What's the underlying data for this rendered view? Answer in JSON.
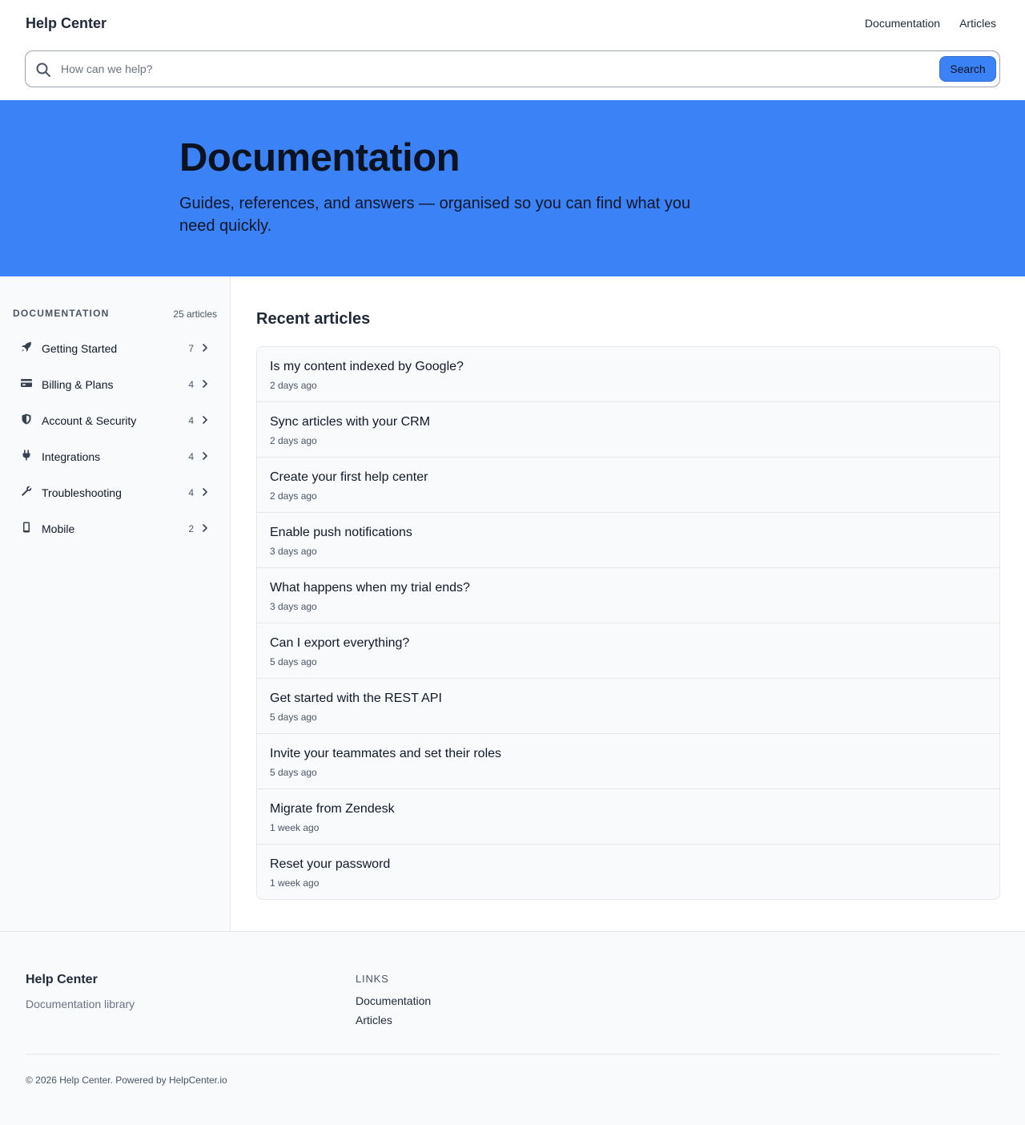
{
  "header": {
    "brand": "Help Center",
    "nav": [
      {
        "label": "Documentation"
      },
      {
        "label": "Articles"
      }
    ],
    "search": {
      "placeholder": "How can we help?",
      "value": "",
      "button_label": "Search"
    }
  },
  "hero": {
    "title": "Documentation",
    "subtitle": "Guides, references, and answers — organised so you can find what you need quickly."
  },
  "sidebar": {
    "heading": "DOCUMENTATION",
    "count_label": "25 articles",
    "items": [
      {
        "label": "Getting Started",
        "count": "7",
        "icon": "rocket-icon"
      },
      {
        "label": "Billing & Plans",
        "count": "4",
        "icon": "credit-card-icon"
      },
      {
        "label": "Account & Security",
        "count": "4",
        "icon": "shield-icon"
      },
      {
        "label": "Integrations",
        "count": "4",
        "icon": "plug-icon"
      },
      {
        "label": "Troubleshooting",
        "count": "4",
        "icon": "wrench-icon"
      },
      {
        "label": "Mobile",
        "count": "2",
        "icon": "mobile-icon"
      }
    ]
  },
  "main": {
    "heading": "Recent articles",
    "articles": [
      {
        "title": "Is my content indexed by Google?",
        "date": "2 days ago"
      },
      {
        "title": "Sync articles with your CRM",
        "date": "2 days ago"
      },
      {
        "title": "Create your first help center",
        "date": "2 days ago"
      },
      {
        "title": "Enable push notifications",
        "date": "3 days ago"
      },
      {
        "title": "What happens when my trial ends?",
        "date": "3 days ago"
      },
      {
        "title": "Can I export everything?",
        "date": "5 days ago"
      },
      {
        "title": "Get started with the REST API",
        "date": "5 days ago"
      },
      {
        "title": "Invite your teammates and set their roles",
        "date": "5 days ago"
      },
      {
        "title": "Migrate from Zendesk",
        "date": "1 week ago"
      },
      {
        "title": "Reset your password",
        "date": "1 week ago"
      }
    ]
  },
  "footer": {
    "brand": "Help Center",
    "tagline": "Documentation library",
    "links_heading": "LINKS",
    "links": [
      {
        "label": "Documentation"
      },
      {
        "label": "Articles"
      }
    ],
    "copyright": "© 2026 Help Center. Powered by HelpCenter.io"
  },
  "colors": {
    "accent": "#3b82f6",
    "text": "#1f2937",
    "muted": "#6b7280",
    "surface": "#f8fafc",
    "border": "#e5e7eb"
  }
}
